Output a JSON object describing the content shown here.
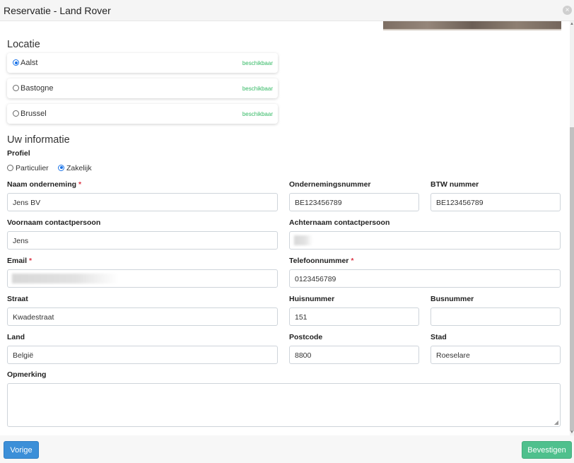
{
  "window": {
    "title": "Reservatie - Land Rover",
    "close_icon": "×"
  },
  "location": {
    "heading": "Locatie",
    "options": [
      {
        "name": "Aalst",
        "status": "beschikbaar",
        "selected": true
      },
      {
        "name": "Bastogne",
        "status": "beschikbaar",
        "selected": false
      },
      {
        "name": "Brussel",
        "status": "beschikbaar",
        "selected": false
      }
    ]
  },
  "info": {
    "heading": "Uw informatie",
    "profile_label": "Profiel",
    "profile_options": [
      {
        "label": "Particulier",
        "selected": false
      },
      {
        "label": "Zakelijk",
        "selected": true
      }
    ]
  },
  "fields": {
    "company_name": {
      "label": "Naam onderneming",
      "required": "*",
      "value": "Jens BV"
    },
    "company_number": {
      "label": "Ondernemingsnummer",
      "value": "BE123456789"
    },
    "vat_number": {
      "label": "BTW nummer",
      "value": "BE123456789"
    },
    "first_name": {
      "label": "Voornaam contactpersoon",
      "value": "Jens"
    },
    "last_name": {
      "label": "Achternaam contactpersoon",
      "value": ""
    },
    "email": {
      "label": "Email",
      "required": "*",
      "value": ""
    },
    "phone": {
      "label": "Telefoonnummer",
      "required": "*",
      "value": "0123456789"
    },
    "street": {
      "label": "Straat",
      "value": "Kwadestraat"
    },
    "house_number": {
      "label": "Huisnummer",
      "value": "151"
    },
    "bus_number": {
      "label": "Busnummer",
      "value": ""
    },
    "country": {
      "label": "Land",
      "value": "België"
    },
    "postcode": {
      "label": "Postcode",
      "value": "8800"
    },
    "city": {
      "label": "Stad",
      "value": "Roeselare"
    },
    "remark": {
      "label": "Opmerking",
      "value": ""
    }
  },
  "footer": {
    "prev_label": "Vorige",
    "confirm_label": "Bevestigen"
  },
  "colors": {
    "primary": "#3c8fd8",
    "success": "#4fc08d",
    "available": "#33b964",
    "required": "#dc3545"
  }
}
